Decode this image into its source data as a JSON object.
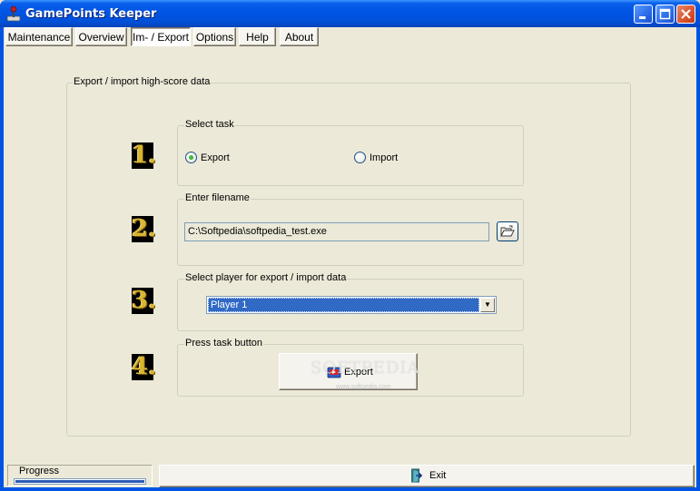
{
  "window": {
    "title": "GamePoints Keeper",
    "controls": [
      "minimize",
      "maximize",
      "close"
    ]
  },
  "tabs": [
    {
      "label": "Maintenance",
      "active": false
    },
    {
      "label": "Overview",
      "active": false
    },
    {
      "label": "Im- / Export",
      "active": true
    },
    {
      "label": "Options",
      "active": false
    },
    {
      "label": "Help",
      "active": false
    },
    {
      "label": "About",
      "active": false
    }
  ],
  "main": {
    "group_title": "Export / import high-score data",
    "steps": {
      "s1": {
        "number": "1.",
        "title": "Select task"
      },
      "s2": {
        "number": "2.",
        "title": "Enter filename"
      },
      "s3": {
        "number": "3.",
        "title": "Select player for export / import data"
      },
      "s4": {
        "number": "4.",
        "title": "Press task button"
      }
    },
    "task_options": [
      {
        "label": "Export",
        "selected": true
      },
      {
        "label": "Import",
        "selected": false
      }
    ],
    "filename": {
      "value": "C:\\Softpedia\\softpedia_test.exe",
      "browse_icon": "folder-open-icon"
    },
    "player_select": {
      "selected": "Player 1"
    },
    "task_button": {
      "label": "Export",
      "icon": "export-icon"
    }
  },
  "watermark": {
    "text": "SOFTPEDIA",
    "sub": "www.softpedia.com"
  },
  "status": {
    "progress_label": "Progress",
    "progress_value": 1.0,
    "exit_label": "Exit",
    "exit_icon": "exit-door-icon"
  },
  "colors": {
    "titlebar": "#0054E3",
    "selection": "#316AC5",
    "step_number": "#D8B630",
    "progress": "#2C5AB6"
  }
}
